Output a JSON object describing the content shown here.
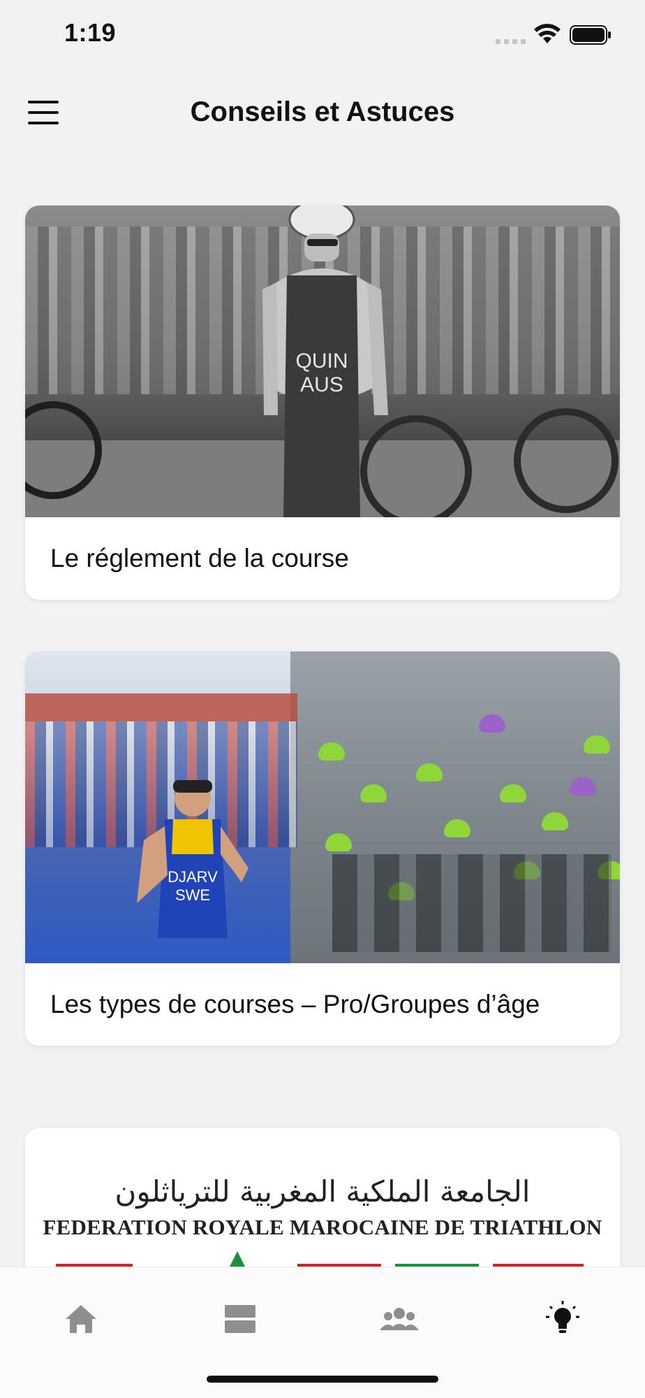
{
  "status_bar": {
    "time": "1:19"
  },
  "app_bar": {
    "title": "Conseils et Astuces",
    "menu_icon": "hamburger-menu-icon"
  },
  "cards": [
    {
      "title": "Le réglement de la course"
    },
    {
      "title": "Les types de courses – Pro/Groupes d’âge"
    },
    {
      "title": "",
      "logo_arabic": "الجامعة الملكية المغربية للترياثلون",
      "logo_text": "FEDERATION ROYALE MAROCAINE DE TRIATHLON"
    }
  ],
  "image_text": {
    "bib_name": "QUIN",
    "bib_country": "AUS",
    "bib2_name": "DJARV",
    "bib2_country": "SWE"
  },
  "bottom_nav": {
    "items": [
      {
        "icon": "home-icon",
        "active": false
      },
      {
        "icon": "list-icon",
        "active": false
      },
      {
        "icon": "group-icon",
        "active": false
      },
      {
        "icon": "lightbulb-icon",
        "active": true
      }
    ]
  },
  "colors": {
    "background": "#f2f2f2",
    "card": "#ffffff",
    "nav_inactive": "#8e8e8e",
    "nav_active": "#111111"
  }
}
